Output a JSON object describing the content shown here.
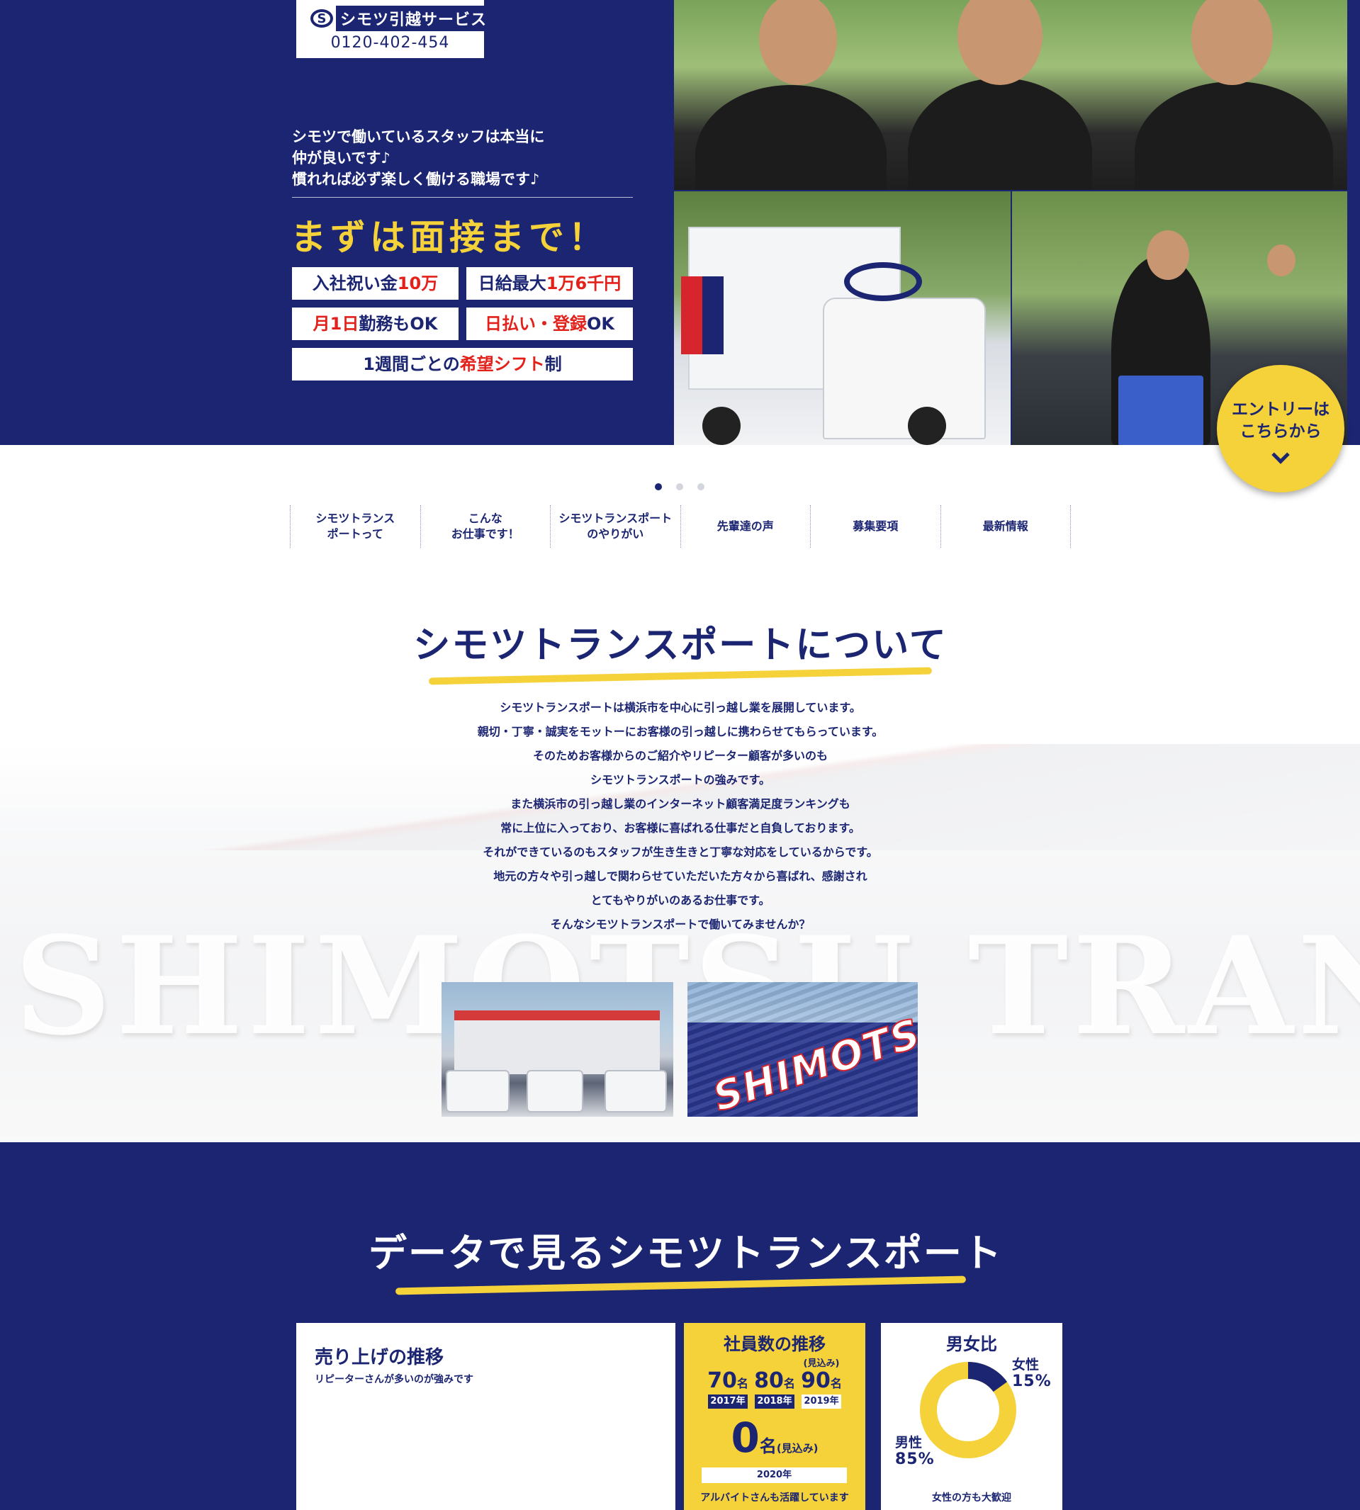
{
  "header": {
    "logo_text": "シモツ引越サービス",
    "logo_mark": "S",
    "phone": "0120-402-454"
  },
  "hero": {
    "copy_lines": [
      "シモツで働いているスタッフは本当に",
      "仲が良いです♪",
      "慣れれば必ず楽しく働ける職場です♪"
    ],
    "cta": "まずは面接まで！",
    "perks": [
      {
        "pre": "入社祝い金",
        "red": "10万",
        "post": ""
      },
      {
        "pre": "日給最大",
        "red": "1万6千円",
        "post": ""
      },
      {
        "pre": "",
        "red": "月1日",
        "post": "勤務もOK"
      },
      {
        "pre": "",
        "red": "日払い・登録",
        "post": "OK"
      },
      {
        "pre": "1週間ごとの",
        "red": "希望シフト",
        "post": "制"
      }
    ],
    "slider_total": 3,
    "slider_active": 1
  },
  "entry_badge": {
    "line1": "エントリーは",
    "line2": "こちらから",
    "icon": "chevron-down-icon"
  },
  "nav": [
    "シモツトランス\nポートって",
    "こんな\nお仕事です！",
    "シモツトランスポート\nのやりがい",
    "先輩達の声",
    "募集要項",
    "最新情報"
  ],
  "about": {
    "title": "シモツトランスポートについて",
    "paragraphs": [
      "シモツトランスポートは横浜市を中心に引っ越し業を展開しています。",
      "親切・丁寧・誠実をモットーにお客様の引っ越しに携わらせてもらっています。",
      "そのためお客様からのご紹介やリピーター顧客が多いのも",
      "シモツトランスポートの強みです。",
      "また横浜市の引っ越し業のインターネット顧客満足度ランキングも",
      "常に上位に入っており、お客様に喜ばれる仕事だと自負しております。",
      "それができているのもスタッフが生き生きと丁寧な対応をしているからです。",
      "地元の方々や引っ越しで関わらせていただいた方々から喜ばれ、感謝され",
      "とてもやりがいのあるお仕事です。",
      "そんなシモツトランスポートで働いてみませんか？"
    ],
    "sign_text": "SHIMOTSU TRANSPORT",
    "photo_right_text": "SHIMOTSU"
  },
  "data_section": {
    "title": "データで見るシモツトランスポート",
    "sales": {
      "title": "売り上げの推移",
      "subtitle": "リピーターさんが多いのが強みです"
    },
    "staff": {
      "title": "社員数の推移",
      "years": [
        {
          "num": "70",
          "unit": "名",
          "year": "2017年",
          "note": ""
        },
        {
          "num": "80",
          "unit": "名",
          "year": "2018年",
          "note": ""
        },
        {
          "num": "90",
          "unit": "名",
          "year": "2019年",
          "note": "(見込み)"
        }
      ],
      "big_num": "0",
      "big_unit": "名",
      "big_note": "(見込み)",
      "big_year": "2020年",
      "footer": "アルバイトさんも活躍しています"
    },
    "gender": {
      "title": "男女比",
      "female_label": "女性",
      "female_value": "15%",
      "female_pct": 15,
      "male_label": "男性",
      "male_value": "85%",
      "male_pct": 85,
      "footer": "女性の方も大歓迎",
      "colors": {
        "female": "#1b2572",
        "male": "#f5d13a"
      }
    }
  },
  "colors": {
    "navy": "#1b2572",
    "yellow": "#f5d13a",
    "red": "#e3211b"
  }
}
